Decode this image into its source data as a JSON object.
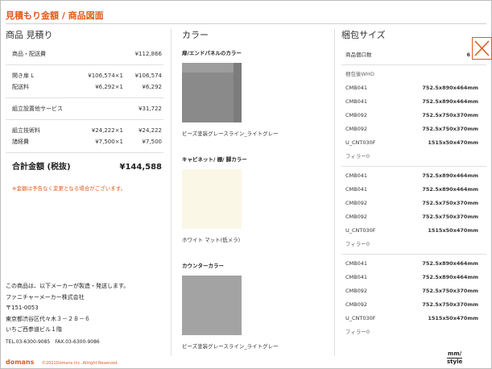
{
  "header": {
    "title": "見積もり金額 / 商品図面"
  },
  "quote": {
    "heading": "商品 見積り",
    "rows_top": [
      {
        "label": "商品・配送費",
        "unit": "",
        "amount": "¥112,866"
      }
    ],
    "rows_items": [
      {
        "label": "開き扉 L",
        "unit": "¥106,574×1",
        "amount": "¥106,574"
      },
      {
        "label": "配送料",
        "unit": "¥6,292×1",
        "amount": "¥6,292"
      }
    ],
    "rows_service": [
      {
        "label": "組立設置他サービス",
        "unit": "",
        "amount": "¥31,722"
      }
    ],
    "rows_fees": [
      {
        "label": "組立技術料",
        "unit": "¥24,222×1",
        "amount": "¥24,222"
      },
      {
        "label": "諸経費",
        "unit": "¥7,500×1",
        "amount": "¥7,500"
      }
    ],
    "total_label": "合計金額 (税抜)",
    "total_amount": "¥144,588",
    "note": "※金額は予告なく変更となる場合がございます。"
  },
  "maker": {
    "lines": [
      "この商品は、以下メーカーが製造・発送します。",
      "ファニチャーメーカー株式会社",
      "〒151-0053",
      "東京都渋谷区代々木３－２８－６",
      "いちご西参道ビル１階"
    ],
    "tel": "TEL.03-6300-9085　FAX.03-6300-9086"
  },
  "footer": {
    "logo": "domans",
    "copyright": "©2021Domans Inc. Allright Reserved."
  },
  "color": {
    "heading": "カラー",
    "sections": [
      {
        "title": "扉/エンドパネルのカラー",
        "name": "ビーズ塗装グレースライン_ライトグレー"
      },
      {
        "title": "キャビネット/ 棚/ 脚カラー",
        "name": "ホワイト マット(低メラ)"
      },
      {
        "title": "カウンターカラー",
        "name": "ビーズ塗装グレースライン_ライトグレー"
      }
    ]
  },
  "pack": {
    "heading": "梱包サイズ",
    "count_label": "商品個口数",
    "count_value": "6",
    "whd_label": "梱包後WHD",
    "groups": [
      [
        {
          "k": "CMB041",
          "v": "752.5x890x464mm"
        },
        {
          "k": "CMB041",
          "v": "752.5x890x464mm"
        },
        {
          "k": "CMB092",
          "v": "752.5x750x370mm"
        },
        {
          "k": "CMB092",
          "v": "752.5x750x370mm"
        },
        {
          "k": "U_CNT030F",
          "v": "1515x50x470mm"
        },
        {
          "k": "フィラー0",
          "v": ""
        }
      ],
      [
        {
          "k": "CMB041",
          "v": "752.5x890x464mm"
        },
        {
          "k": "CMB041",
          "v": "752.5x890x464mm"
        },
        {
          "k": "CMB092",
          "v": "752.5x750x370mm"
        },
        {
          "k": "CMB092",
          "v": "752.5x750x370mm"
        },
        {
          "k": "U_CNT030F",
          "v": "1515x50x470mm"
        },
        {
          "k": "フィラー0",
          "v": ""
        }
      ],
      [
        {
          "k": "CMB041",
          "v": "752.5x890x464mm"
        },
        {
          "k": "CMB041",
          "v": "752.5x890x464mm"
        },
        {
          "k": "CMB092",
          "v": "752.5x750x370mm"
        },
        {
          "k": "CMB092",
          "v": "752.5x750x370mm"
        },
        {
          "k": "U_CNT030F",
          "v": "1515x50x470mm"
        },
        {
          "k": "フィラー0",
          "v": ""
        }
      ]
    ]
  },
  "brand": {
    "top": "mm/",
    "bottom": "style"
  },
  "colors": {
    "accent": "#e05a1b",
    "swatch_door": "#8a8a8a",
    "swatch_cabinet": "#fbf7e7",
    "swatch_counter": "#a3a3a3"
  },
  "icons": {
    "close": "close-icon"
  }
}
